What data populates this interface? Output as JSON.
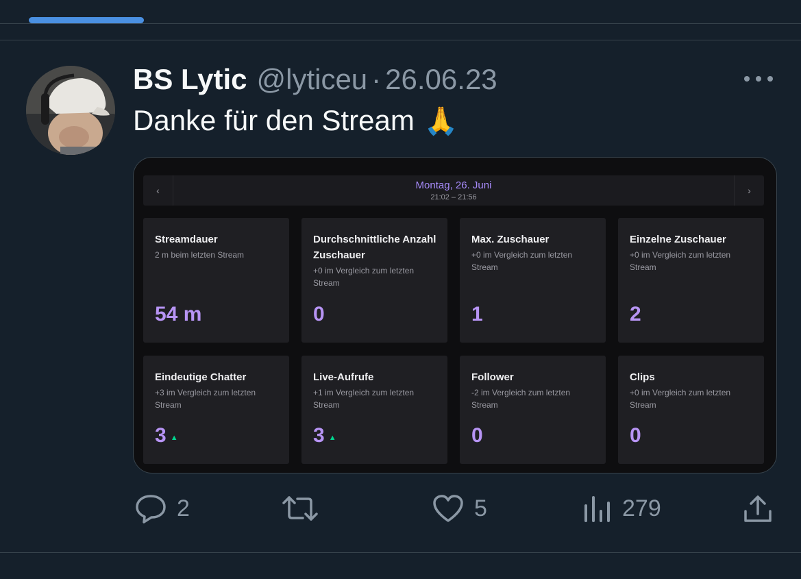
{
  "tweet": {
    "display_name": "BS Lytic",
    "handle": "@lyticeu",
    "separator": "·",
    "date": "26.06.23",
    "text": "Danke für den Stream",
    "emoji": "🙏"
  },
  "media": {
    "nav": {
      "prev_icon": "‹",
      "next_icon": "›",
      "date": "Montag, 26. Juni",
      "time": "21:02 – 21:56"
    },
    "cards": [
      {
        "title": "Streamdauer",
        "subtitle": "2 m beim letzten Stream",
        "value": "54 m",
        "trend": ""
      },
      {
        "title": "Durchschnittliche Anzahl Zuschauer",
        "subtitle": "+0 im Vergleich zum letzten Stream",
        "value": "0",
        "trend": ""
      },
      {
        "title": "Max. Zuschauer",
        "subtitle": "+0 im Vergleich zum letzten Stream",
        "value": "1",
        "trend": ""
      },
      {
        "title": "Einzelne Zuschauer",
        "subtitle": "+0 im Vergleich zum letzten Stream",
        "value": "2",
        "trend": ""
      },
      {
        "title": "Eindeutige Chatter",
        "subtitle": "+3 im Vergleich zum letzten Stream",
        "value": "3",
        "trend": "▲"
      },
      {
        "title": "Live-Aufrufe",
        "subtitle": "+1 im Vergleich zum letzten Stream",
        "value": "3",
        "trend": "▲"
      },
      {
        "title": "Follower",
        "subtitle": "-2 im Vergleich zum letzten Stream",
        "value": "0",
        "trend": ""
      },
      {
        "title": "Clips",
        "subtitle": "+0 im Vergleich zum letzten Stream",
        "value": "0",
        "trend": ""
      }
    ]
  },
  "actions": {
    "reply_count": "2",
    "retweet_count": "",
    "like_count": "5",
    "views_count": "279"
  },
  "icons": {
    "reply": "reply-icon",
    "retweet": "retweet-icon",
    "like": "heart-icon",
    "views": "views-icon",
    "share": "share-icon",
    "more": "more-icon"
  },
  "colors": {
    "background": "#15202b",
    "accent": "#4a90e2",
    "muted": "#8b98a5",
    "stat_value": "#b794f4",
    "trend_up": "#00d68f"
  }
}
